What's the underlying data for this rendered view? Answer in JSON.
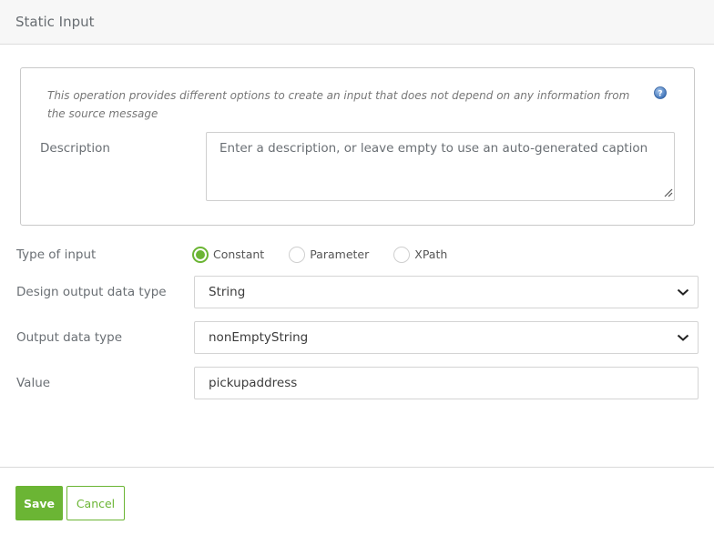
{
  "header": {
    "title": "Static Input"
  },
  "info": {
    "text": "This operation provides different options to create an input that does not depend on any information from the source message",
    "help_icon": "help-question-icon"
  },
  "description": {
    "label": "Description",
    "placeholder": "Enter a description, or leave empty to use an auto-generated caption",
    "value": ""
  },
  "type_of_input": {
    "label": "Type of input",
    "options": [
      {
        "label": "Constant",
        "checked": true
      },
      {
        "label": "Parameter",
        "checked": false
      },
      {
        "label": "XPath",
        "checked": false
      }
    ]
  },
  "design_output_data_type": {
    "label": "Design output data type",
    "value": "String"
  },
  "output_data_type": {
    "label": "Output data type",
    "value": "nonEmptyString"
  },
  "value_field": {
    "label": "Value",
    "value": "pickupaddress"
  },
  "footer": {
    "save_label": "Save",
    "cancel_label": "Cancel"
  },
  "colors": {
    "accent": "#6bb534",
    "header_bg": "#f7f7f7"
  }
}
